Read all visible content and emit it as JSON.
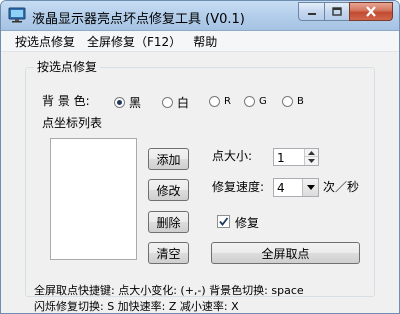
{
  "window": {
    "title": "液晶显示器亮点坏点修复工具 (V0.1)"
  },
  "menu": [
    "按选点修复",
    "全屏修复（F12）",
    "帮助"
  ],
  "group": {
    "title": "按选点修复"
  },
  "background": {
    "label": "背 景 色:",
    "options": [
      {
        "label": "黑",
        "checked": true,
        "small": false
      },
      {
        "label": "白",
        "checked": false,
        "small": false
      },
      {
        "label": "R",
        "checked": false,
        "small": true
      },
      {
        "label": "G",
        "checked": false,
        "small": true
      },
      {
        "label": "B",
        "checked": false,
        "small": true
      }
    ]
  },
  "list": {
    "label": "点坐标列表",
    "items": []
  },
  "buttons": {
    "add": "添加",
    "modify": "修改",
    "delete": "删除",
    "clear": "清空",
    "fullscreen": "全屏取点"
  },
  "point_size": {
    "label": "点大小:",
    "value": "1"
  },
  "repair_speed": {
    "label": "修复速度:",
    "value": "4",
    "unit": "次／秒"
  },
  "repair_check": {
    "label": "修复",
    "checked": true
  },
  "hints": {
    "line1": "全屏取点快捷键: 点大小变化: (+,-)  背景色切换: space",
    "line2": "闪烁修复切换: S  加快速率: Z  减小速率: X"
  },
  "colors": {
    "accent": "#1f3a5e",
    "titlebar": "#b2cdea",
    "close": "#c24a30"
  }
}
